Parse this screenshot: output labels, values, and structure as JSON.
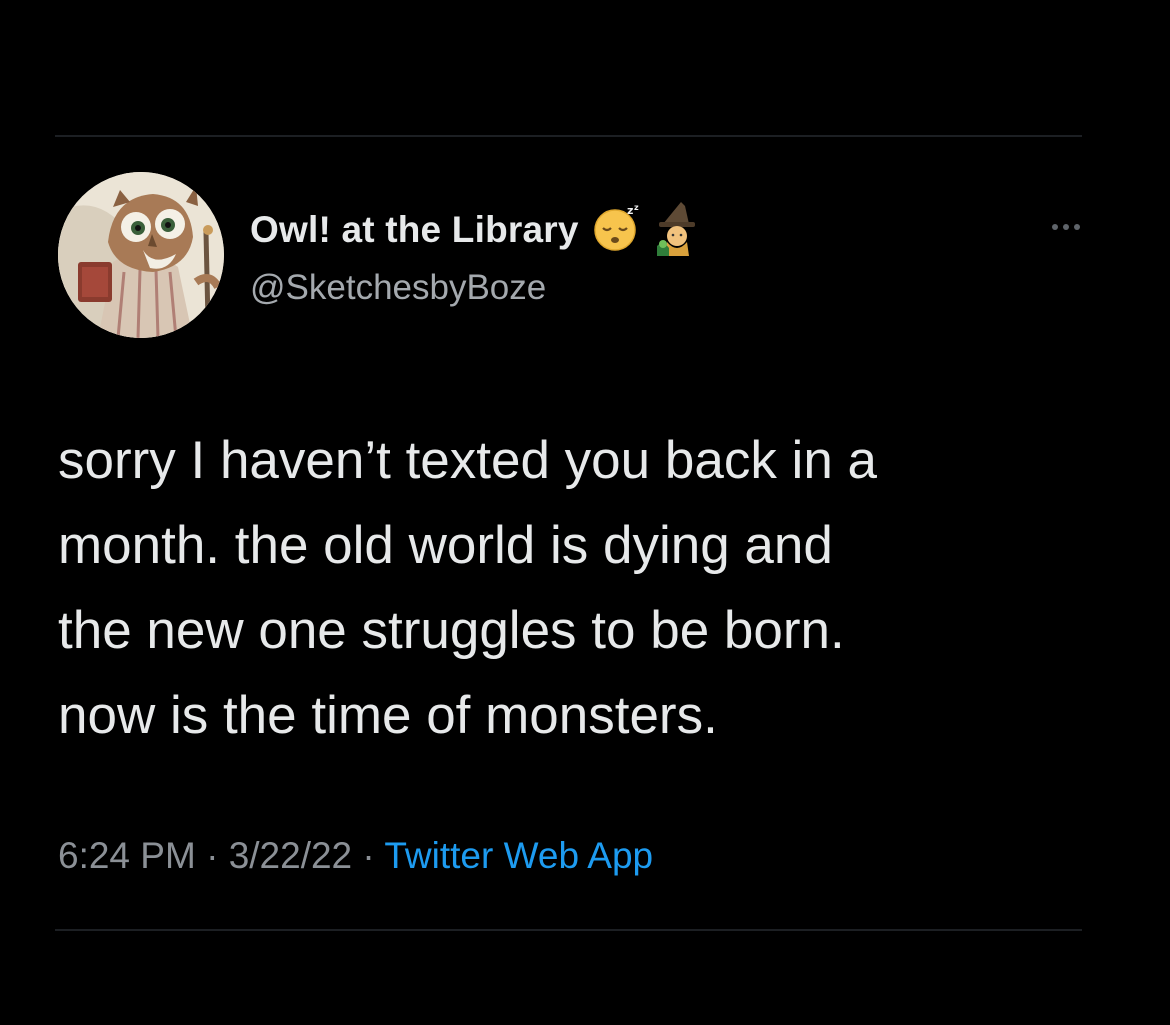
{
  "tweet": {
    "author": {
      "display_name": "Owl! at the Library",
      "handle": "@SketchesbyBoze",
      "name_emojis": [
        "sleeping-face-emoji",
        "mage-emoji"
      ]
    },
    "more_icon": "more-horizontal-icon",
    "text_lines": [
      "sorry I haven’t texted you back in a",
      "month. the old world is dying and",
      "the new one struggles to be born.",
      "now is the time of monsters."
    ],
    "time": "6:24 PM",
    "date": "3/22/22",
    "separator": "·",
    "source": "Twitter Web App"
  },
  "colors": {
    "background": "#000000",
    "primary_text": "#e7e9ea",
    "secondary_text": "#8b9096",
    "link": "#1d9bf0",
    "divider": "#1c1f23"
  }
}
